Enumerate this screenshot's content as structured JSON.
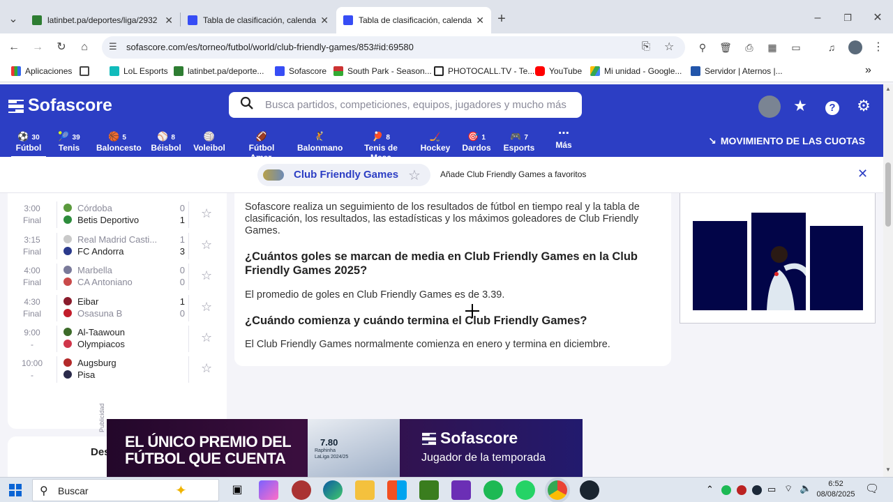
{
  "browser": {
    "tabs": [
      {
        "title": "latinbet.pa/deportes/liga/2932",
        "active": false
      },
      {
        "title": "Tabla de clasificación, calendari",
        "active": false
      },
      {
        "title": "Tabla de clasificación, calendari",
        "active": true
      }
    ],
    "url": "sofascore.com/es/torneo/futbol/world/club-friendly-games/853#id:69580",
    "bookmarks": [
      "Aplicaciones",
      "LoL Esports",
      "latinbet.pa/deporte...",
      "Sofascore",
      "South Park - Season...",
      "PHOTOCALL.TV - Te...",
      "YouTube",
      "Mi unidad - Google...",
      "Servidor | Aternos |..."
    ]
  },
  "site": {
    "logo": "Sofascore",
    "search_placeholder": "Busca partidos, competiciones, equipos, jugadores y mucho más",
    "sports": [
      {
        "label": "Fútbol",
        "count": "30",
        "icon": "⚽"
      },
      {
        "label": "Tenis",
        "count": "39",
        "icon": "🎾"
      },
      {
        "label": "Baloncesto",
        "count": "5",
        "icon": "🏀"
      },
      {
        "label": "Béisbol",
        "count": "8",
        "icon": "⚾"
      },
      {
        "label": "Voleibol",
        "count": "",
        "icon": "🏐"
      },
      {
        "label": "Fútbol Amer.",
        "count": "",
        "icon": "🏈"
      },
      {
        "label": "Balonmano",
        "count": "",
        "icon": "🤾"
      },
      {
        "label": "Tenis de Mesa",
        "count": "8",
        "icon": "🏓"
      },
      {
        "label": "Hockey",
        "count": "",
        "icon": "🏒"
      },
      {
        "label": "Dardos",
        "count": "1",
        "icon": "🎯"
      },
      {
        "label": "Esports",
        "count": "7",
        "icon": "🎮"
      },
      {
        "label": "Más",
        "count": "",
        "icon": "⋯"
      }
    ],
    "odds_label": "MOVIMIENTO DE LAS CUOTAS",
    "colors": {
      "brand": "#2c3ec4"
    }
  },
  "favbar": {
    "name": "Club Friendly Games",
    "text": "Añade Club Friendly Games a favoritos"
  },
  "matches": [
    {
      "time": "3:00",
      "status": "Final",
      "home": "Córdoba",
      "away": "Betis Deportivo",
      "hs": "0",
      "as": "1",
      "home_dim": true,
      "away_dim": false
    },
    {
      "time": "3:15",
      "status": "Final",
      "home": "Real Madrid Casti...",
      "away": "FC Andorra",
      "hs": "1",
      "as": "3",
      "home_dim": true,
      "away_dim": false
    },
    {
      "time": "4:00",
      "status": "Final",
      "home": "Marbella",
      "away": "CA Antoniano",
      "hs": "0",
      "as": "0",
      "home_dim": true,
      "away_dim": true
    },
    {
      "time": "4:30",
      "status": "Final",
      "home": "Eibar",
      "away": "Osasuna B",
      "hs": "1",
      "as": "0",
      "home_dim": false,
      "away_dim": true
    },
    {
      "time": "9:00",
      "status": "-",
      "home": "Al-Taawoun",
      "away": "Olympiacos",
      "hs": "",
      "as": "",
      "home_dim": false,
      "away_dim": false
    },
    {
      "time": "10:00",
      "status": "-",
      "home": "Augsburg",
      "away": "Pisa",
      "hs": "",
      "as": "",
      "home_dim": false,
      "away_dim": false
    }
  ],
  "partial_text": "Des",
  "faq": {
    "intro": "Sofascore realiza un seguimiento de los resultados de fútbol en tiempo real y la tabla de clasificación, los resultados, las estadísticas y los máximos goleadores de Club Friendly Games.",
    "q1": "¿Cuántos goles se marcan de media en Club Friendly Games en la Club Friendly Games 2025?",
    "a1": "El promedio de goles en Club Friendly Games es de 3.39.",
    "q2": "¿Cuándo comienza y cuándo termina el Club Friendly Games?",
    "a2": "El Club Friendly Games normalmente comienza en enero y termina en diciembre."
  },
  "banner": {
    "headline_1": "EL ÚNICO PREMIO DEL",
    "headline_2": "FÚTBOL QUE CUENTA",
    "rating": "7.80",
    "card_sub_1": "Raphinha",
    "card_sub_2": "LaLiga 2024/25",
    "brand": "Sofascore",
    "tagline": "Jugador de la temporada",
    "side_label": "Publicidad"
  },
  "taskbar": {
    "search_label": "Buscar",
    "time": "6:52",
    "date": "08/08/2025"
  }
}
